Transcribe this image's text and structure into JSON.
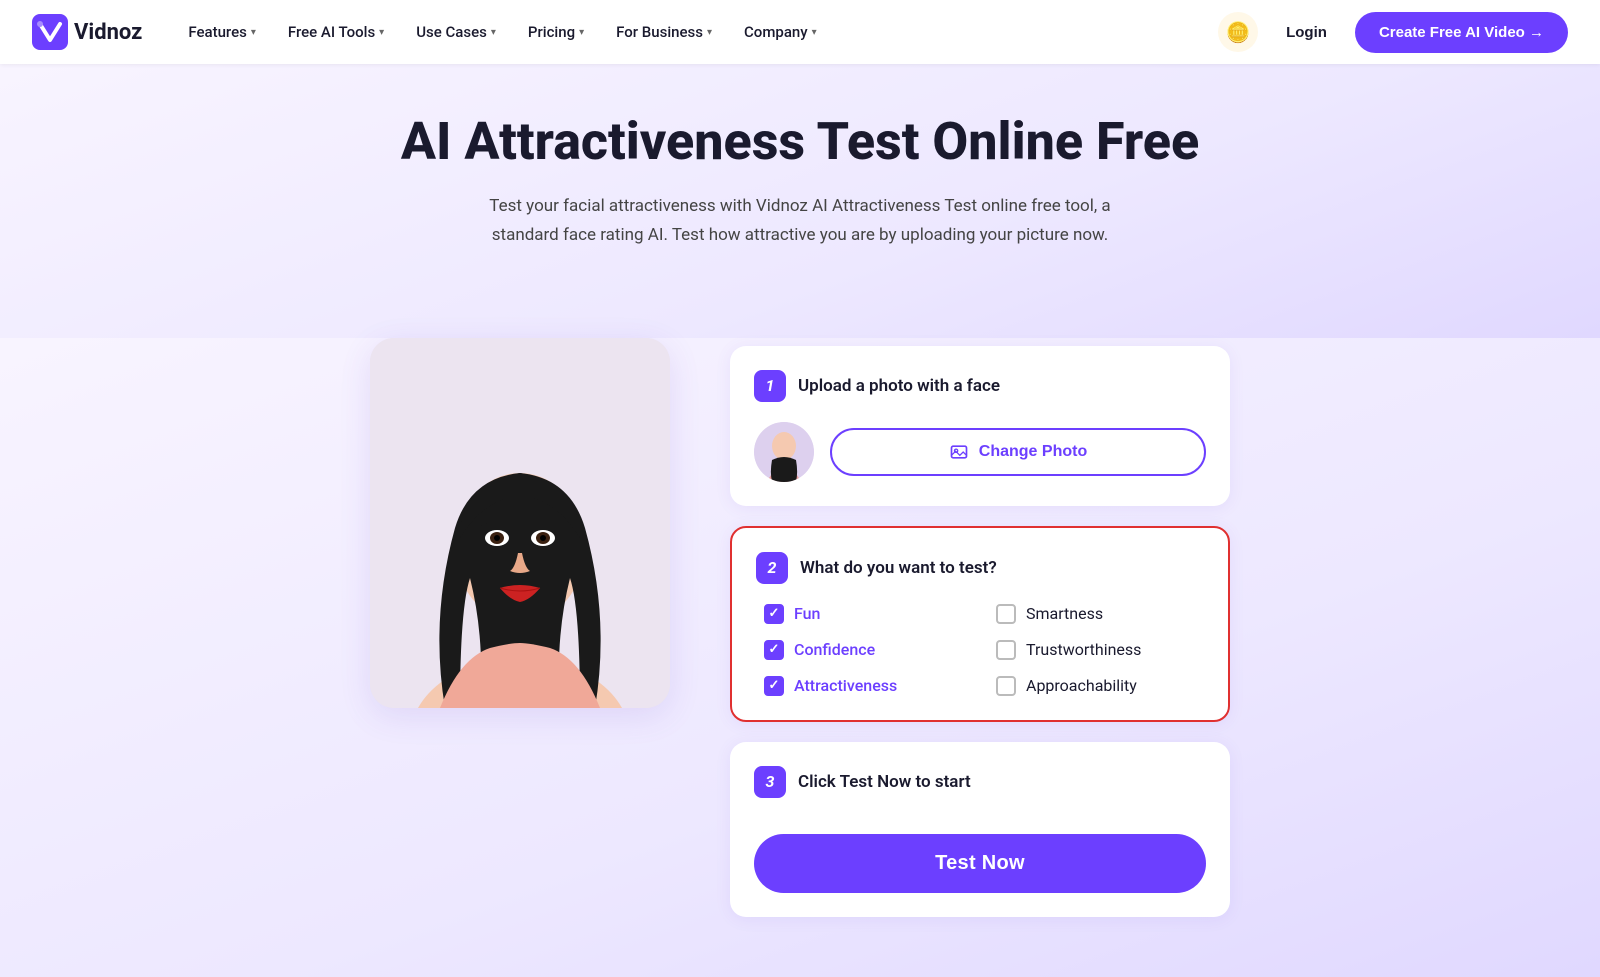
{
  "navbar": {
    "logo_text": "Vidnoz",
    "nav_items": [
      {
        "label": "Features",
        "has_dropdown": true
      },
      {
        "label": "Free AI Tools",
        "has_dropdown": true
      },
      {
        "label": "Use Cases",
        "has_dropdown": true
      },
      {
        "label": "Pricing",
        "has_dropdown": true
      },
      {
        "label": "For Business",
        "has_dropdown": true
      },
      {
        "label": "Company",
        "has_dropdown": true
      }
    ],
    "login_label": "Login",
    "cta_label": "Create Free AI Video →"
  },
  "hero": {
    "title": "AI Attractiveness Test Online Free",
    "subtitle": "Test your facial attractiveness with Vidnoz AI Attractiveness Test online free tool, a standard face rating AI. Test how attractive you are by uploading your picture now."
  },
  "step1": {
    "badge": "1",
    "title": "Upload a photo with a face",
    "change_photo_label": "Change Photo"
  },
  "step2": {
    "badge": "2",
    "title": "What do you want to test?",
    "checkboxes": [
      {
        "label": "Fun",
        "checked": true
      },
      {
        "label": "Smartness",
        "checked": false
      },
      {
        "label": "Confidence",
        "checked": true
      },
      {
        "label": "Trustworthiness",
        "checked": false
      },
      {
        "label": "Attractiveness",
        "checked": true
      },
      {
        "label": "Approachability",
        "checked": false
      }
    ]
  },
  "step3": {
    "badge": "3",
    "title": "Click Test Now to start",
    "button_label": "Test Now"
  }
}
